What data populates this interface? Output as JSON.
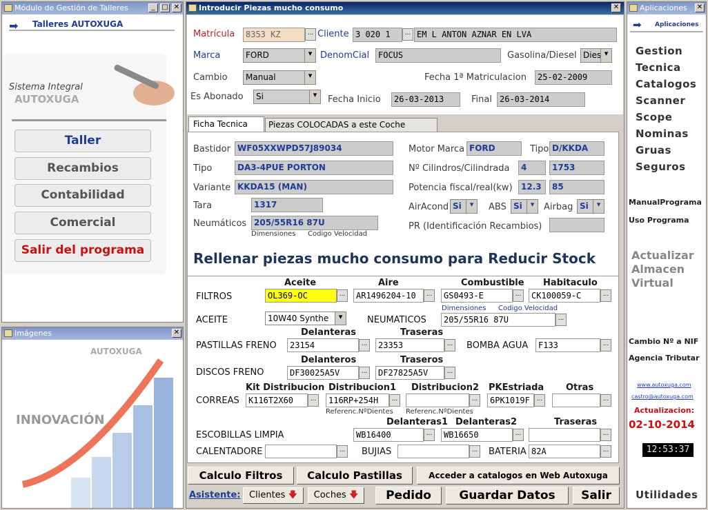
{
  "left_window": {
    "title": "Módulo de Gestión de Talleres",
    "heading": "Talleres AUTOXUGA",
    "system_text": "Sistema Integral",
    "brand": "AUTOXUGA",
    "menu": [
      "Taller",
      "Recambios",
      "Contabilidad",
      "Comercial",
      "Salir del programa"
    ]
  },
  "images_window": {
    "title": "Imágenes",
    "brand": "AUTOXUGA",
    "slogan": "INNOVACIÓN"
  },
  "main_window": {
    "title": "Introducir Piezas mucho consumo"
  },
  "vehicle": {
    "matricula_label": "Matrícula",
    "matricula": "8353  KZ",
    "cliente_label": "Cliente",
    "cliente_code": "3  020  1",
    "cliente_name": "EM L  ANTON  AZNAR  EN  LVA",
    "marca_label": "Marca",
    "marca": "FORD",
    "denom_label": "DenomCial",
    "denom": "FOCUS",
    "fuel_label": "Gasolina/Diesel",
    "fuel": "Dies",
    "cambio_label": "Cambio",
    "cambio": "Manual",
    "fecha1_label": "Fecha 1ª Matriculacion",
    "fecha1": "25-02-2009",
    "abonado_label": "Es Abonado",
    "abonado": "Si",
    "inicio_label": "Fecha Inicio",
    "inicio": "26-03-2013",
    "final_label": "Final",
    "final": "26-03-2014"
  },
  "tabs": [
    "Ficha Tecnica",
    "Piezas COLOCADAS a este Coche"
  ],
  "ficha": {
    "bastidor_label": "Bastidor",
    "bastidor": "WF05XXWPD57J89034",
    "tipo_label": "Tipo",
    "tipo": "DA3-4PUE PORTON",
    "variante_label": "Variante",
    "variante": "KKDA15 (MAN)",
    "tara_label": "Tara",
    "tara": "1317",
    "neum_label": "Neumáticos",
    "neum": "205/55R16 87U",
    "neum_dim": "Dimensiones",
    "neum_cod": "Codigo Velocidad",
    "motor_label": "Motor Marca",
    "motor": "FORD",
    "tipo2_label": "Tipo",
    "tipo2": "D/KKDA",
    "cil_label": "Nº Cilindros/Cilindrada",
    "cil": "4",
    "cilindrada": "1753",
    "pot_label": "Potencia fiscal/real(kw)",
    "pot_f": "12.3",
    "pot_r": "85",
    "aircond_label": "AirAcond",
    "aircond": "Si",
    "abs_label": "ABS",
    "abs": "Si",
    "airbag_label": "Airbag",
    "airbag": "Si",
    "pr_label": "PR (Identificación Recambios)"
  },
  "banner": "Rellenar piezas mucho consumo para Reducir Stock",
  "parts": {
    "filtros_label": "FILTROS",
    "h_aceite": "Aceite",
    "h_aire": "Aire",
    "h_comb": "Combustible",
    "h_hab": "Habitaculo",
    "f_aceite": "OL369-OC",
    "f_aire": "AR1496204-10",
    "f_comb": "GS0493-E",
    "f_hab": "CK100059-C",
    "aceite_label": "ACEITE",
    "aceite": "10W40 Synthe",
    "neumaticos_label": "NEUMATICOS",
    "neumaticos": "205/55R16 87U",
    "neu_dim": "Dimensiones",
    "neu_cod": "Codigo Velocidad",
    "pastillas_label": "PASTILLAS FRENO",
    "h_del": "Delanteras",
    "h_tras": "Traseras",
    "past_del": "23154",
    "past_tras": "23353",
    "bomba_label": "BOMBA AGUA",
    "bomba": "F133",
    "discos_label": "DISCOS FRENO",
    "h_del2": "Delanteros",
    "h_tras2": "Traseros",
    "disc_del": "DF30025A5V",
    "disc_tras": "DF27825A5V",
    "correas_label": "CORREAS",
    "h_kit": "Kit Distribucion",
    "h_d1": "Distribucion1",
    "h_d2": "Distribucion2",
    "h_pk": "PKEstriada",
    "h_otras": "Otras",
    "kit": "K116T2X60",
    "d1": "116RP+254H",
    "pk": "6PK1019F",
    "ref1": "Referenc.NºDientes",
    "ref2": "Referenc.NºDientes",
    "escobillas_label": "ESCOBILLAS LIMPIA",
    "h_ed1": "Delanteras1",
    "h_ed2": "Delanteras2",
    "h_et": "Traseras",
    "esc1": "WB16400",
    "esc2": "WB16650",
    "calent_label": "CALENTADORE",
    "bujias_label": "BUJIAS",
    "bateria_label": "BATERIA",
    "bateria": "82A"
  },
  "buttons": {
    "calc_filtros": "Calculo Filtros",
    "calc_pastillas": "Calculo Pastillas",
    "catalogos": "Acceder a catalogos en Web Autoxuga",
    "asistente": "Asistente:",
    "clientes": "Clientes",
    "coches": "Coches",
    "pedido": "Pedido",
    "guardar": "Guardar Datos",
    "salir": "Salir"
  },
  "right_window": {
    "title": "Aplicaciones",
    "heading": "Aplicaciones",
    "menu": [
      "Gestion",
      "Tecnica",
      "Catalogos",
      "Scanner",
      "Scope",
      "Nominas",
      "Gruas",
      "Seguros"
    ],
    "manual": "ManualPrograma",
    "uso": "Uso Programa",
    "actualizar": [
      "Actualizar",
      "Almacen",
      "Virtual"
    ],
    "cambio": "Cambio Nº a NIF",
    "agencia": "Agencia Tributar",
    "web": "www.autoxuga.com",
    "mail": "castro@autoxuga.com",
    "act_label": "Actualizacion:",
    "act_date": "02-10-2014",
    "clock": "12:53:37",
    "utilidades": "Utilidades"
  }
}
